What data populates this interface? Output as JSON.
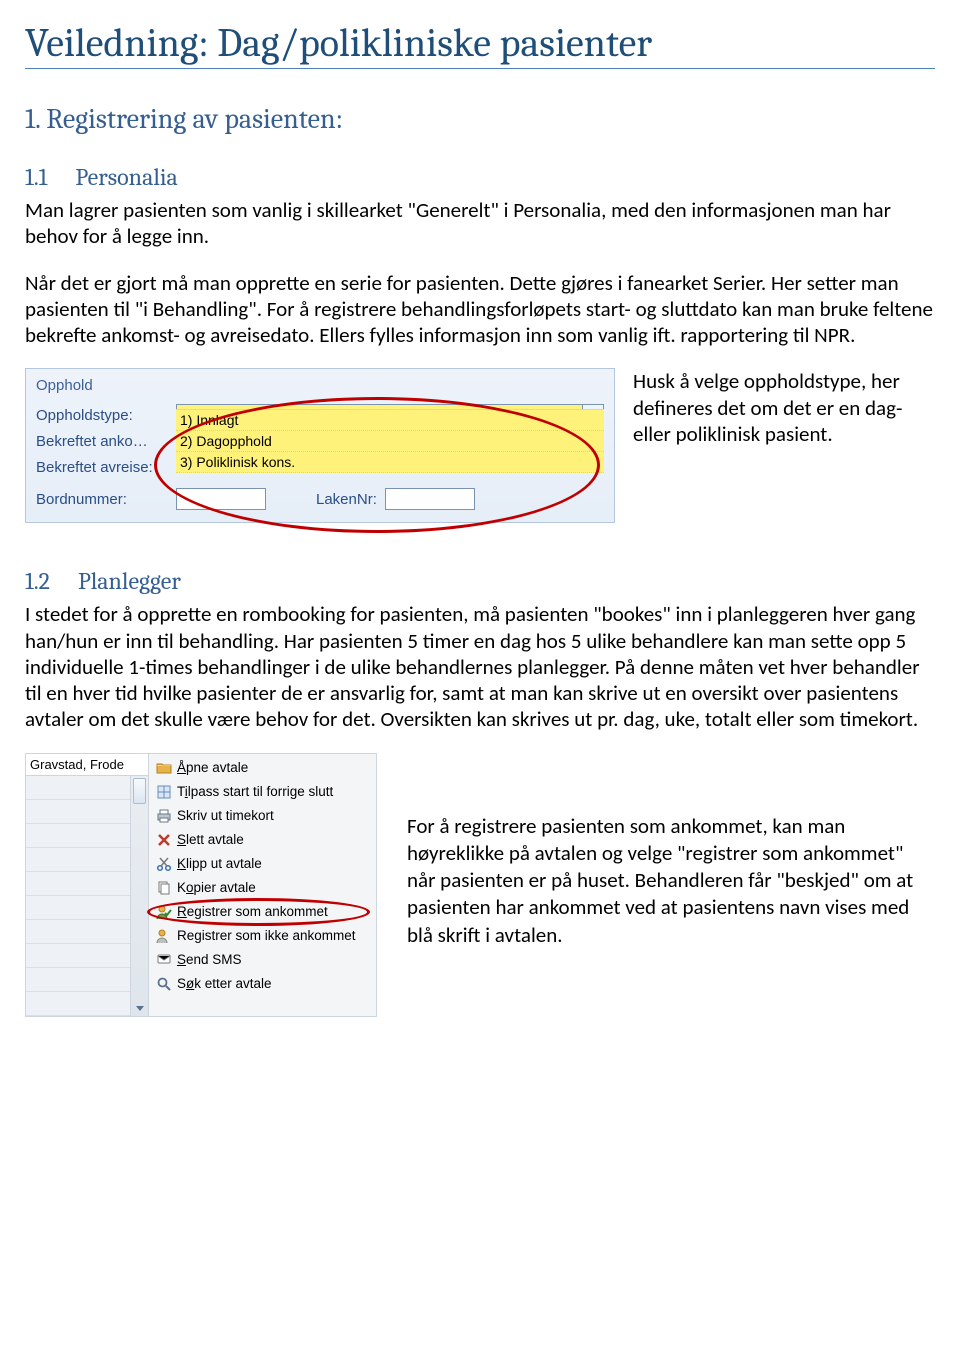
{
  "title": "Veiledning: Dag/polikliniske pasienter",
  "sec1": {
    "num": "1.",
    "title": "Registrering av pasienten:"
  },
  "sec11": {
    "num": "1.1",
    "title": "Personalia",
    "para": "Man lagrer pasienten som vanlig i skillearket \"Generelt\" i Personalia, med den informasjonen man har behov for å legge inn.",
    "para2": "Når det er gjort må man opprette en serie for pasienten. Dette gjøres i fanearket Serier. Her setter man pasienten til \"i Behandling\". For å registrere behandlingsforløpets start- og sluttdato kan man bruke feltene bekrefte ankomst- og avreisedato. Ellers fylles informasjon inn som vanlig ift. rapportering til NPR.",
    "aside": "Husk å velge oppholdstype, her defineres det om det er en dag- eller poliklinisk pasient."
  },
  "opphold": {
    "header": "Opphold",
    "labels": {
      "type": "Oppholdstype:",
      "anko": "Bekreftet anko…",
      "avreise": "Bekreftet avreise:",
      "bord": "Bordnummer:",
      "laken": "LakenNr:"
    },
    "selected": "1) Innlagt",
    "options": [
      "1) Innlagt",
      "2) Dagopphold",
      "3) Poliklinisk kons."
    ]
  },
  "sec12": {
    "num": "1.2",
    "title": "Planlegger",
    "para": "I stedet for å opprette en rombooking for pasienten, må pasienten \"bookes\" inn i planleggeren hver gang han/hun er inn til behandling. Har pasienten 5 timer en dag hos 5 ulike behandlere kan man sette opp 5 individuelle 1-times behandlinger i de ulike behandlernes planlegger. På denne måten vet hver behandler til en hver tid hvilke pasienter de er ansvarlig for, samt at man kan skrive ut en oversikt over pasientens avtaler om det skulle være behov for det. Oversikten kan skrives ut pr. dag, uke, totalt eller som timekort.",
    "aside": "For å registrere pasienten som ankommet, kan man høyreklikke på avtalen og velge \"registrer som ankommet\" når pasienten er på huset.  Behandleren får \"beskjed\" om at pasienten har ankommet ved at pasientens navn vises med blå skrift i avtalen."
  },
  "ctx": {
    "patient": "Gravstad, Frode",
    "items": [
      {
        "icon": "folder-open",
        "label": "Åpne avtale",
        "u": 0
      },
      {
        "icon": "resize",
        "label": "Tilpass start til forrige slutt",
        "u": 1
      },
      {
        "icon": "print",
        "label": "Skriv ut timekort",
        "u": -1
      },
      {
        "icon": "delete",
        "label": "Slett avtale",
        "u": 0
      },
      {
        "icon": "cut",
        "label": "Klipp ut avtale",
        "u": 0
      },
      {
        "icon": "copy",
        "label": "Kopier avtale",
        "u": 1
      },
      {
        "icon": "person-check",
        "label": "Registrer som ankommet",
        "u": 0,
        "hl": true
      },
      {
        "icon": "person-x",
        "label": "Registrer som ikke ankommet",
        "u": -1
      },
      {
        "icon": "sms",
        "label": "Send SMS",
        "u": 0
      },
      {
        "icon": "search",
        "label": "Søk etter avtale",
        "u": 1
      }
    ]
  }
}
